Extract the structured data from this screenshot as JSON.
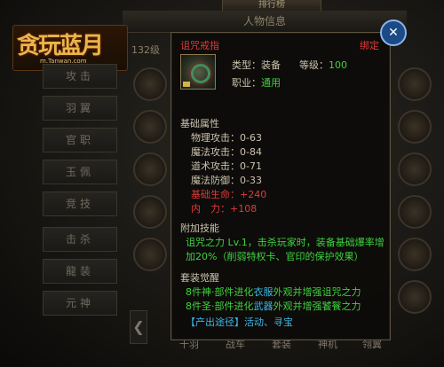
{
  "background": {
    "rank_title": "排行榜",
    "info_title": "人物信息",
    "logo_main": "贪玩蓝月",
    "logo_url": "m.Tanwan.com",
    "level_prefix": "132级",
    "left_buttons": [
      "攻击",
      "羽翼",
      "官职",
      "玉佩",
      "竞技",
      "击杀",
      "龍装",
      "元神"
    ],
    "bottom_tabs": [
      "十羽",
      "战车",
      "套装",
      "神机",
      "翎翼"
    ],
    "nav_left": "❮"
  },
  "close_button": {
    "icon": "close-icon",
    "glyph": "✕"
  },
  "tooltip": {
    "item_name": "诅咒戒指",
    "bound": "绑定",
    "type_label": "类型：",
    "type_value": "装备",
    "level_label": "等级：",
    "level_value": "100",
    "job_label": "职业：",
    "job_value": "通用",
    "base_title": "基础属性",
    "base_stats": [
      {
        "label": "物理攻击：",
        "value": "0-63"
      },
      {
        "label": "魔法攻击：",
        "value": "0-84"
      },
      {
        "label": "道术攻击：",
        "value": "0-71"
      },
      {
        "label": "魔法防御：",
        "value": "0-33"
      }
    ],
    "extra_stats": [
      {
        "label": "基础生命：",
        "value": "+240"
      },
      {
        "label": "内　力：",
        "value": "+108"
      }
    ],
    "skill_title": "附加技能",
    "skill_line1": "诅咒之力 Lv.1，击杀玩家时，装备基础爆率增",
    "skill_line2": "加20%（削弱特权卡、官印的保护效果）",
    "set_title": "套装觉醒",
    "set_line1_prefix": "8件神·部件进化",
    "set_line1_hl": "衣服",
    "set_line1_suffix": "外观并增强诅咒之力",
    "set_line2_prefix": "8件圣·部件进化",
    "set_line2_hl": "武器",
    "set_line2_suffix": "外观并增强饕餮之力",
    "source_bracket": "【产出途径】",
    "source_value": "活动、寻宝"
  },
  "colors": {
    "name_red": "#e23a3a",
    "green": "#3ed23e",
    "blue": "#3ab8e8"
  }
}
